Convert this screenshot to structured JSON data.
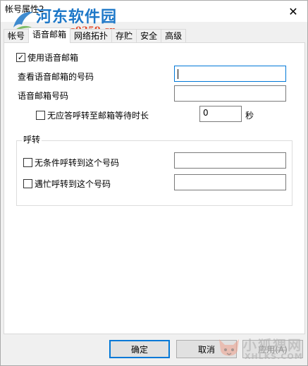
{
  "window": {
    "title": "帐号属性2",
    "close_glyph": "✕"
  },
  "watermark_top": {
    "name": "河东软件园",
    "url": "www.pc0359.cn"
  },
  "tabs": [
    {
      "label": "帐号",
      "active": false
    },
    {
      "label": "语音邮箱",
      "active": true
    },
    {
      "label": "网络拓扑",
      "active": false
    },
    {
      "label": "存贮",
      "active": false
    },
    {
      "label": "安全",
      "active": false
    },
    {
      "label": "高级",
      "active": false
    }
  ],
  "voicemail": {
    "use_voicemail_label": "使用语音邮箱",
    "use_voicemail_checked": true,
    "check_number_label": "查看语音邮箱的号码",
    "check_number_value": "",
    "mailbox_number_label": "语音邮箱号码",
    "mailbox_number_value": "",
    "no_answer_label": "无应答呼转至邮箱等待时长",
    "no_answer_checked": false,
    "wait_value": "0",
    "wait_unit": "秒"
  },
  "forward": {
    "group_title": "呼转",
    "unconditional_label": "无条件呼转到这个号码",
    "unconditional_checked": false,
    "unconditional_value": "",
    "busy_label": "遇忙呼转到这个号码",
    "busy_checked": false,
    "busy_value": ""
  },
  "buttons": {
    "ok": "确定",
    "cancel": "取消",
    "apply": "应用(A)"
  },
  "watermark_bottom": {
    "name": "小狐狸网",
    "url": "XHLKS.COM"
  }
}
